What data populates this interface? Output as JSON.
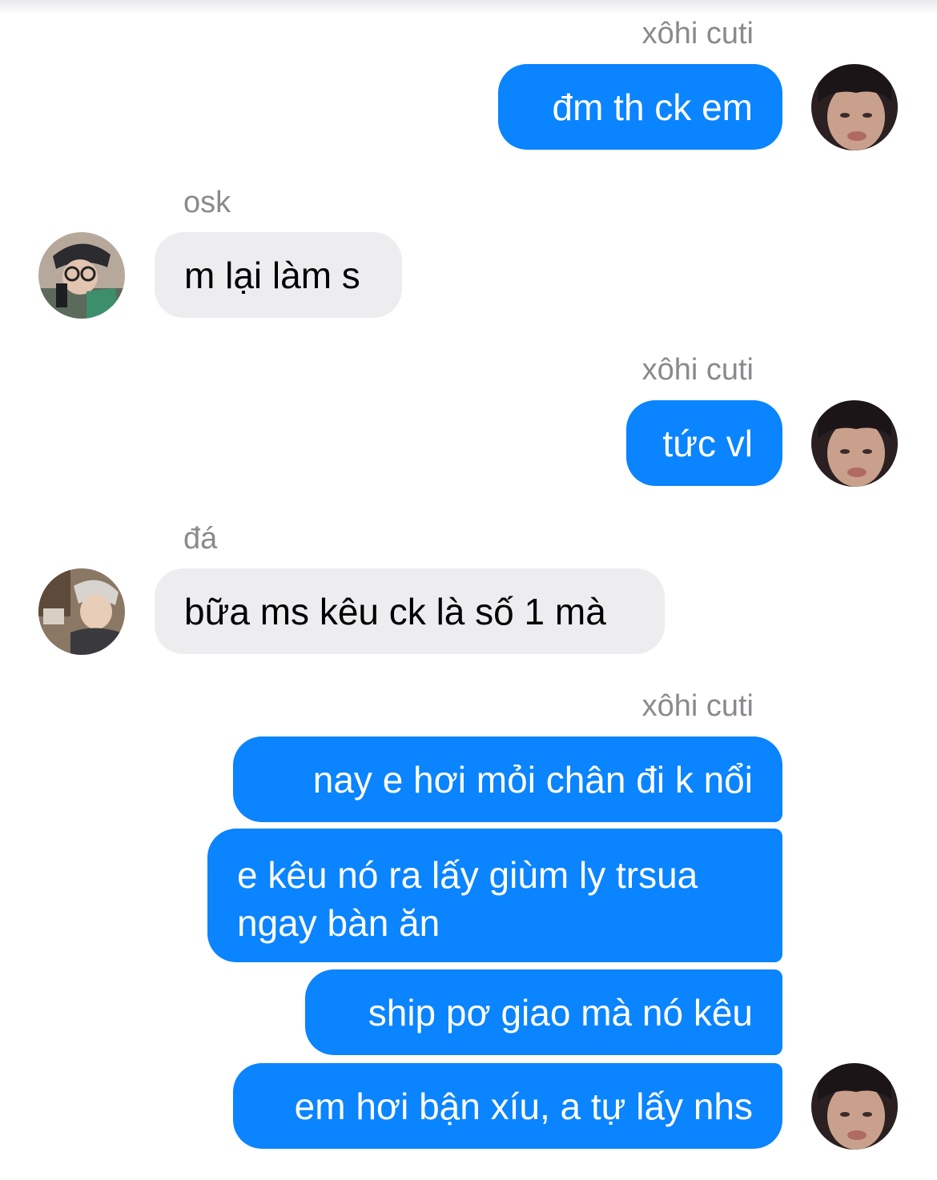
{
  "messages": [
    {
      "sender": "xôhi cuti",
      "text": "đm th ck em"
    },
    {
      "sender": "osk",
      "text": "m lại làm s"
    },
    {
      "sender": "xôhi cuti",
      "text": "tức vl"
    },
    {
      "sender": "đá",
      "text": "bữa ms kêu ck là số 1 mà"
    },
    {
      "sender": "xôhi cuti",
      "texts": [
        "nay e hơi mỏi chân đi k nổi",
        "e kêu nó ra lấy giùm ly trsua ngay bàn ăn",
        "ship pơ giao mà nó kêu",
        "em hơi bận xíu, a tự lấy nhs"
      ]
    }
  ],
  "colors": {
    "outgoing_bubble": "#0a84ff",
    "incoming_bubble": "#ededf0",
    "sender_label": "#8a8a8e"
  }
}
